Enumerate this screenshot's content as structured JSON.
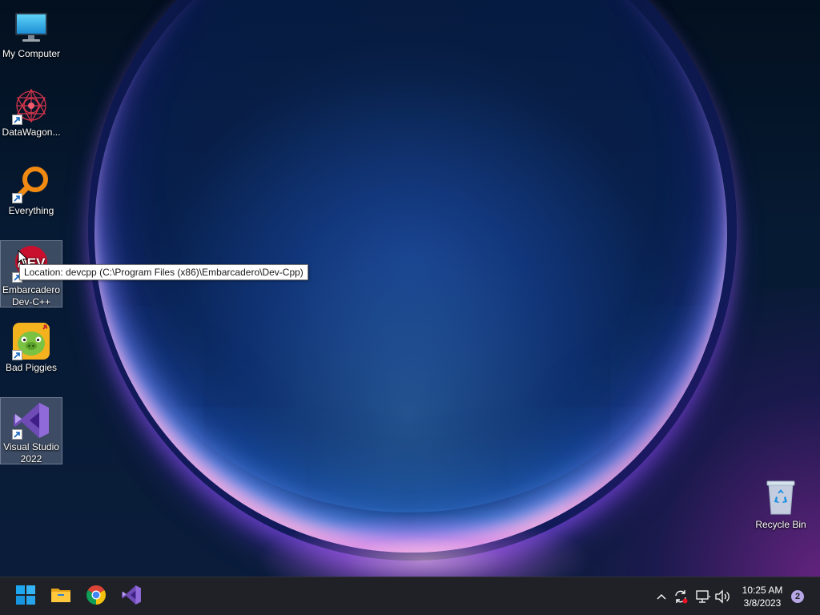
{
  "desktop": {
    "icons": [
      {
        "name": "my-computer",
        "label": "My Computer",
        "shortcut": false
      },
      {
        "name": "datawagon",
        "label": "DataWagon...",
        "shortcut": true
      },
      {
        "name": "everything",
        "label": "Everything",
        "shortcut": true
      },
      {
        "name": "embarcadero-devcpp",
        "label": "Embarcadero Dev-C++",
        "shortcut": true,
        "icon_text": "DEV"
      },
      {
        "name": "bad-piggies",
        "label": "Bad Piggies",
        "shortcut": true
      },
      {
        "name": "visual-studio-2022",
        "label": "Visual Studio 2022",
        "shortcut": true
      },
      {
        "name": "recycle-bin",
        "label": "Recycle Bin",
        "shortcut": false
      }
    ],
    "tooltip": "Location: devcpp (C:\\Program Files (x86)\\Embarcadero\\Dev-Cpp)"
  },
  "taskbar": {
    "pinned": [
      {
        "name": "start-button",
        "icon": "windows-logo-icon"
      },
      {
        "name": "file-explorer-button",
        "icon": "folder-icon"
      },
      {
        "name": "chrome-button",
        "icon": "chrome-icon"
      },
      {
        "name": "visual-studio-button",
        "icon": "visual-studio-icon"
      }
    ],
    "tray": {
      "icons": [
        "chevron-up-icon",
        "sync-icon",
        "network-icon",
        "volume-icon"
      ],
      "time": "10:25 AM",
      "date": "3/8/2023",
      "notification_count": "2"
    }
  },
  "colors": {
    "taskbar_bg": "#1f2126",
    "windows_blue": "#1ea7f0",
    "chrome_red": "#db4437",
    "chrome_yellow": "#f4c20d",
    "chrome_green": "#0f9d58",
    "vs_purple": "#8661c5",
    "notification_badge": "#b7a7e6"
  }
}
